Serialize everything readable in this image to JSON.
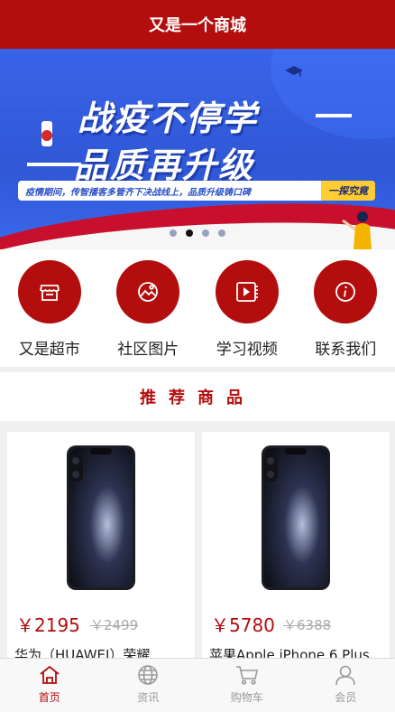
{
  "header": {
    "title": "又是一个商城"
  },
  "banner": {
    "headline_1": "战疫不停学",
    "headline_2": "品质再升级",
    "strip_text": "疫情期间，传智播客多管齐下决战线上，品质升级铸口碑",
    "strip_button": "一探究竟",
    "dot_count": 4,
    "active_dot": 1
  },
  "quick_entries": [
    {
      "label": "又是超市",
      "icon": "store-icon"
    },
    {
      "label": "社区图片",
      "icon": "image-icon"
    },
    {
      "label": "学习视频",
      "icon": "video-icon"
    },
    {
      "label": "联系我们",
      "icon": "info-icon"
    }
  ],
  "recommend": {
    "title": "推荐商品"
  },
  "products": [
    {
      "price": "￥2195",
      "original_price": "￥2499",
      "name": "华为（HUAWEI）荣耀"
    },
    {
      "price": "￥5780",
      "original_price": "￥6388",
      "name": "苹果Apple iPhone 6 Plus"
    }
  ],
  "tabbar": [
    {
      "label": "首页",
      "icon": "home-icon",
      "active": true
    },
    {
      "label": "资讯",
      "icon": "globe-icon",
      "active": false
    },
    {
      "label": "购物车",
      "icon": "cart-icon",
      "active": false
    },
    {
      "label": "会员",
      "icon": "user-icon",
      "active": false
    }
  ],
  "colors": {
    "brand": "#b30d0d",
    "background": "#f0f0f0",
    "tab_inactive": "#9a9a9a"
  }
}
